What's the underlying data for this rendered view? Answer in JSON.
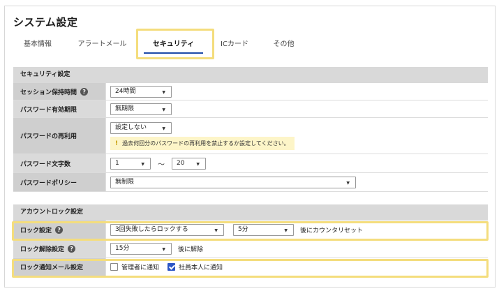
{
  "page_title": "システム設定",
  "tabs": [
    {
      "label": "基本情報"
    },
    {
      "label": "アラートメール"
    },
    {
      "label": "セキュリティ"
    },
    {
      "label": "ICカード"
    },
    {
      "label": "その他"
    }
  ],
  "active_tab": "セキュリティ",
  "security": {
    "header": "セキュリティ設定",
    "session": {
      "label": "セッション保持時間",
      "value": "24時間"
    },
    "password_expiry": {
      "label": "パスワード有効期限",
      "value": "無期限"
    },
    "password_reuse": {
      "label": "パスワードの再利用",
      "value": "設定しない",
      "notice": "過去何回分のパスワードの再利用を禁止するか設定してください。"
    },
    "password_length": {
      "label": "パスワード文字数",
      "min": "1",
      "separator": "～",
      "max": "20"
    },
    "password_policy": {
      "label": "パスワードポリシー",
      "value": "無制限"
    }
  },
  "account_lock": {
    "header": "アカウントロック設定",
    "lock": {
      "label": "ロック設定",
      "attempts": "3回失敗したらロックする",
      "duration": "5分",
      "suffix": "後にカウンタリセット"
    },
    "unlock": {
      "label": "ロック解除設定",
      "value": "15分",
      "suffix": "後に解除"
    },
    "notify": {
      "label": "ロック通知メール設定",
      "admin": {
        "label": "管理者に通知",
        "checked": false
      },
      "employee": {
        "label": "社員本人に通知",
        "checked": true
      }
    }
  },
  "colors": {
    "accent": "#1e4aa8",
    "highlight": "#f4dd7d",
    "notice_bg": "#fdf5c8",
    "checkbox": "#2b55c5"
  }
}
